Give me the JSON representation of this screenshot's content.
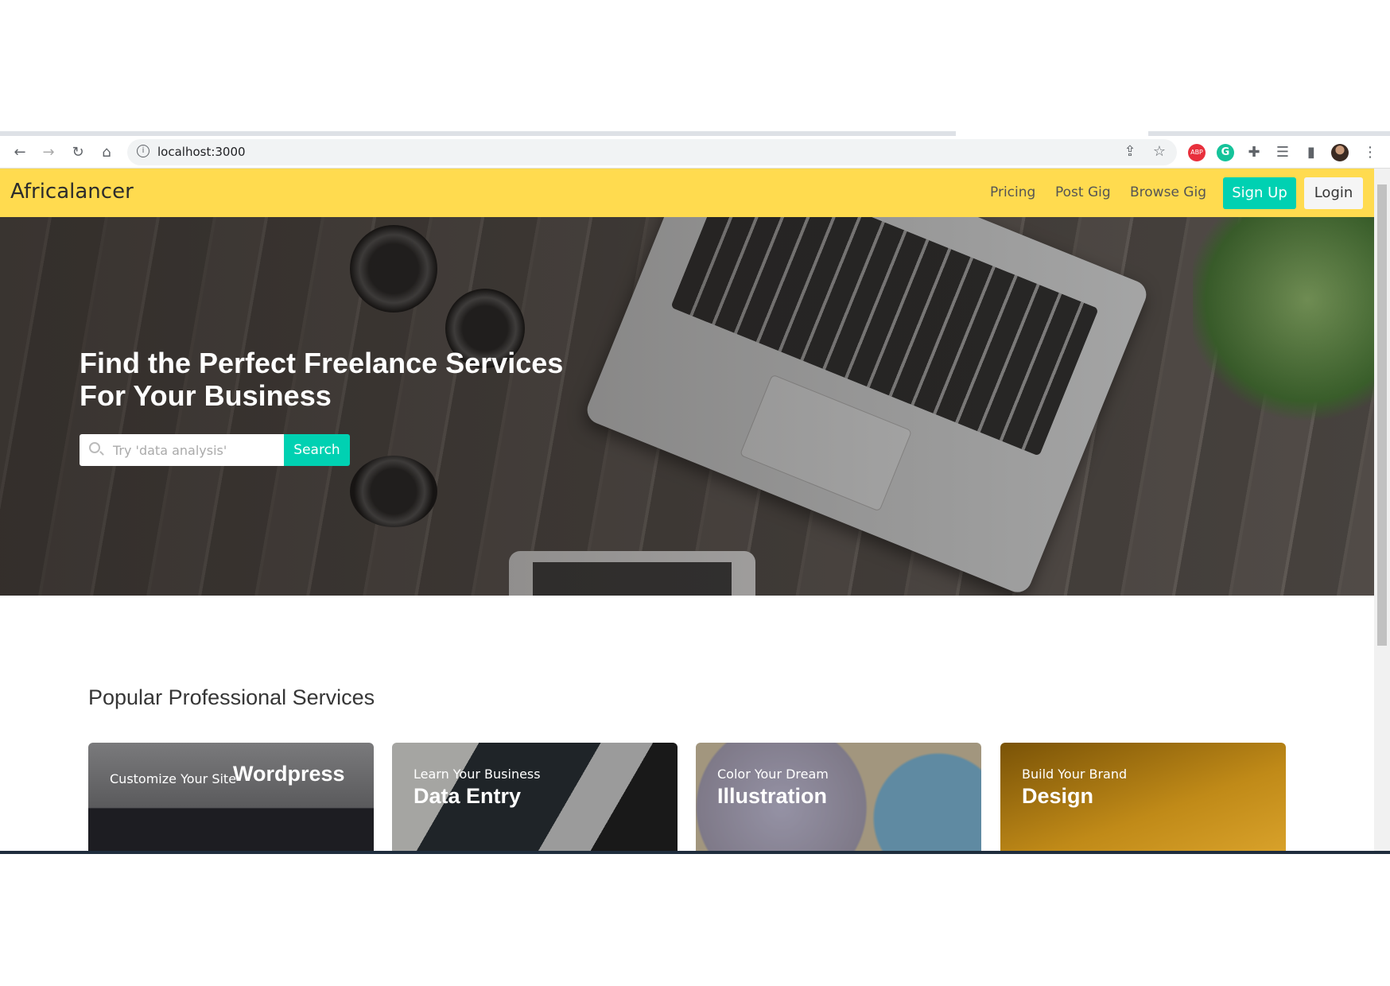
{
  "browser": {
    "url": "localhost:3000",
    "icons": [
      "back-icon",
      "forward-icon",
      "reload-icon",
      "home-icon",
      "share-icon",
      "star-icon",
      "adblock-icon",
      "grammarly-icon",
      "extensions-icon",
      "reading-list-icon",
      "side-panel-icon",
      "profile-avatar",
      "menu-icon"
    ],
    "abp": "ABP",
    "g": "G"
  },
  "nav": {
    "brand": "Africalancer",
    "links": [
      "Pricing",
      "Post Gig",
      "Browse Gig"
    ],
    "signup": "Sign Up",
    "login": "Login",
    "color": "#ffdb4f",
    "accent": "#00d1b2"
  },
  "hero": {
    "title_line1": "Find the Perfect Freelance Services",
    "title_line2": "For Your Business",
    "search_placeholder": "Try 'data analysis'",
    "search_button": "Search"
  },
  "services": {
    "title": "Popular Professional Services",
    "cards": [
      {
        "sub": "Customize Your Site",
        "main": "Wordpress"
      },
      {
        "sub": "Learn Your Business",
        "main": "Data Entry"
      },
      {
        "sub": "Color Your Dream",
        "main": "Illustration"
      },
      {
        "sub": "Build Your Brand",
        "main": "Design"
      }
    ]
  }
}
